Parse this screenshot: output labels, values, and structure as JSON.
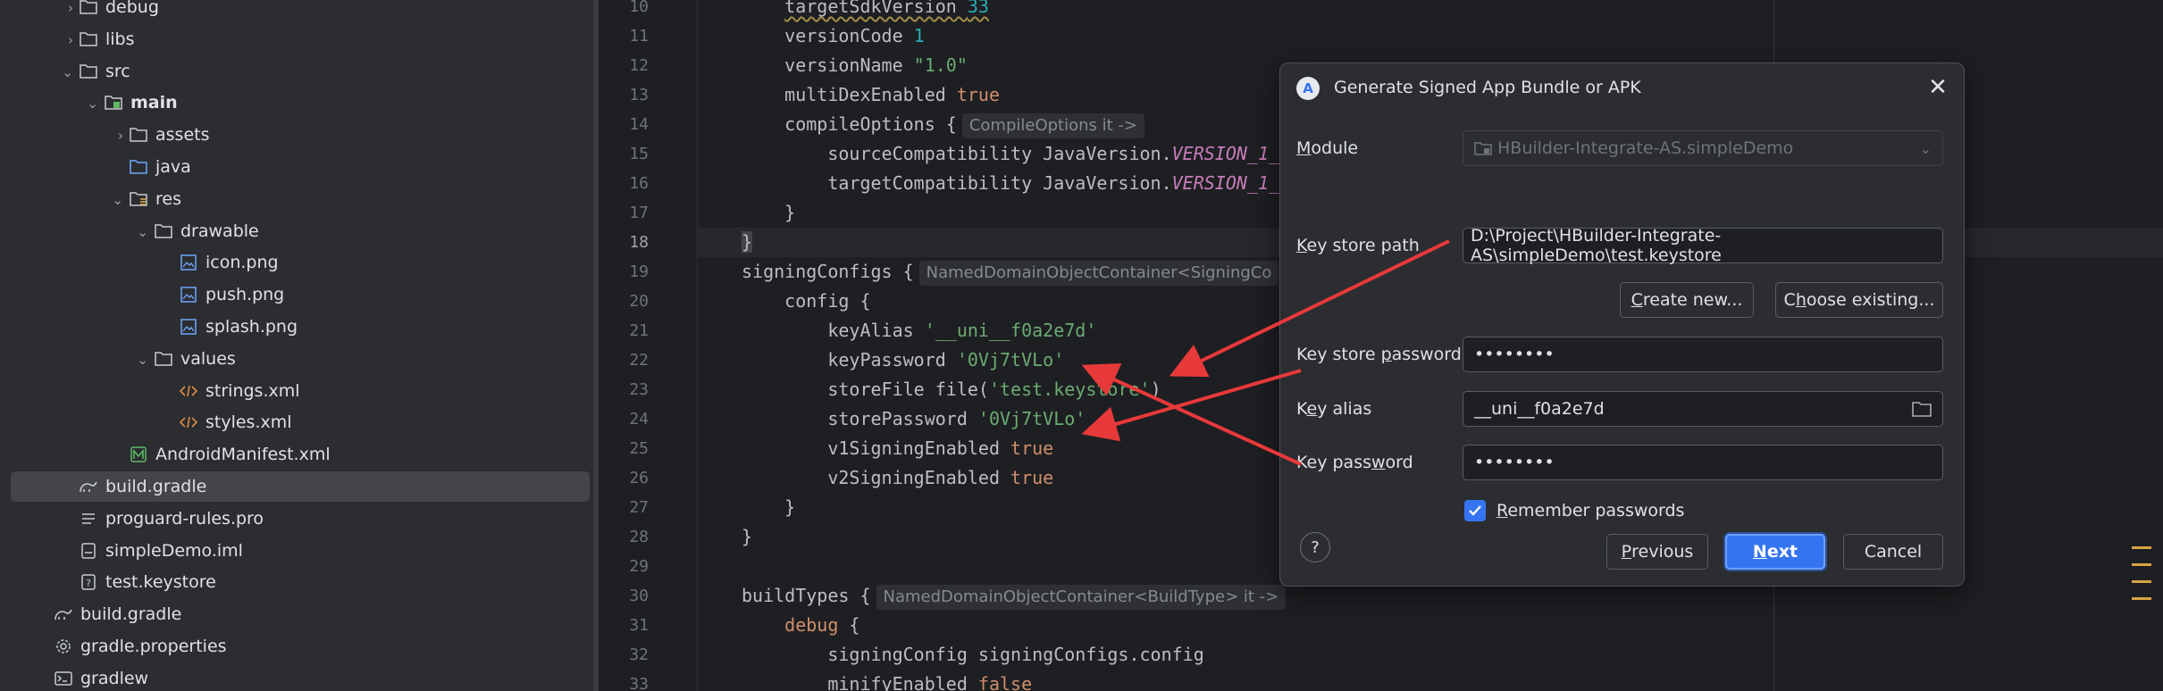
{
  "tree": {
    "items": [
      {
        "label": "debug",
        "depth": 2,
        "chevron": "›",
        "icon": "folder-icon"
      },
      {
        "label": "libs",
        "depth": 2,
        "chevron": "›",
        "icon": "folder-icon"
      },
      {
        "label": "src",
        "depth": 2,
        "chevron": "⌄",
        "icon": "folder-icon"
      },
      {
        "label": "main",
        "depth": 3,
        "chevron": "⌄",
        "icon": "source-folder-icon",
        "bold": true
      },
      {
        "label": "assets",
        "depth": 4,
        "chevron": "›",
        "icon": "folder-icon"
      },
      {
        "label": "java",
        "depth": 4,
        "chevron": "",
        "icon": "java-folder-icon"
      },
      {
        "label": "res",
        "depth": 4,
        "chevron": "⌄",
        "icon": "res-folder-icon"
      },
      {
        "label": "drawable",
        "depth": 5,
        "chevron": "⌄",
        "icon": "folder-icon"
      },
      {
        "label": "icon.png",
        "depth": 6,
        "chevron": "",
        "icon": "image-file-icon"
      },
      {
        "label": "push.png",
        "depth": 6,
        "chevron": "",
        "icon": "image-file-icon"
      },
      {
        "label": "splash.png",
        "depth": 6,
        "chevron": "",
        "icon": "image-file-icon"
      },
      {
        "label": "values",
        "depth": 5,
        "chevron": "⌄",
        "icon": "folder-icon"
      },
      {
        "label": "strings.xml",
        "depth": 6,
        "chevron": "",
        "icon": "xml-file-icon"
      },
      {
        "label": "styles.xml",
        "depth": 6,
        "chevron": "",
        "icon": "xml-file-icon"
      },
      {
        "label": "AndroidManifest.xml",
        "depth": 4,
        "chevron": "",
        "icon": "manifest-file-icon"
      },
      {
        "label": "build.gradle",
        "depth": 2,
        "chevron": "",
        "icon": "gradle-file-icon",
        "selected": true
      },
      {
        "label": "proguard-rules.pro",
        "depth": 2,
        "chevron": "",
        "icon": "text-file-icon"
      },
      {
        "label": "simpleDemo.iml",
        "depth": 2,
        "chevron": "",
        "icon": "iml-file-icon"
      },
      {
        "label": "test.keystore",
        "depth": 2,
        "chevron": "",
        "icon": "unknown-file-icon"
      },
      {
        "label": "build.gradle",
        "depth": 1,
        "chevron": "",
        "icon": "gradle-file-icon"
      },
      {
        "label": "gradle.properties",
        "depth": 1,
        "chevron": "",
        "icon": "settings-file-icon"
      },
      {
        "label": "gradlew",
        "depth": 1,
        "chevron": "",
        "icon": "terminal-file-icon"
      }
    ]
  },
  "editor": {
    "current_line": "18",
    "lines": [
      {
        "n": "10",
        "html": "    <span class=\"under\">targetSdkVersion <span class=\"num\">33</span></span>"
      },
      {
        "n": "11",
        "html": "    versionCode <span class=\"num\">1</span>"
      },
      {
        "n": "12",
        "html": "    versionName <span class=\"str\">\"1.0\"</span>"
      },
      {
        "n": "13",
        "html": "    multiDexEnabled <span class=\"kw\">true</span>"
      },
      {
        "n": "14",
        "html": "    compileOptions {<span class=\"hint\">CompileOptions it -&gt;</span>"
      },
      {
        "n": "15",
        "html": "        sourceCompatibility JavaVersion.<span class=\"const\">VERSION_1_</span>"
      },
      {
        "n": "16",
        "html": "        targetCompatibility JavaVersion.<span class=\"const\">VERSION_1_</span>"
      },
      {
        "n": "17",
        "html": "    }"
      },
      {
        "n": "18",
        "html": "<span class=\"brace-hl\">}</span>"
      },
      {
        "n": "19",
        "html": "signingConfigs {<span class=\"hint\">NamedDomainObjectContainer&lt;SigningCo</span>"
      },
      {
        "n": "20",
        "html": "    config {"
      },
      {
        "n": "21",
        "html": "        keyAlias <span class=\"str\">'__uni__f0a2e7d'</span>"
      },
      {
        "n": "22",
        "html": "        keyPassword <span class=\"str\">'0Vj7tVLo'</span>"
      },
      {
        "n": "23",
        "html": "        storeFile file(<span class=\"str\">'test.keystore'</span>)"
      },
      {
        "n": "24",
        "html": "        storePassword <span class=\"str\">'0Vj7tVLo'</span>"
      },
      {
        "n": "25",
        "html": "        v1SigningEnabled <span class=\"kw\">true</span>"
      },
      {
        "n": "26",
        "html": "        v2SigningEnabled <span class=\"kw\">true</span>"
      },
      {
        "n": "27",
        "html": "    }"
      },
      {
        "n": "28",
        "html": "}"
      },
      {
        "n": "29",
        "html": ""
      },
      {
        "n": "30",
        "html": "buildTypes {<span class=\"hint\">NamedDomainObjectContainer&lt;BuildType&gt; it -&gt;</span>"
      },
      {
        "n": "31",
        "html": "    <span class=\"kw\">debug</span> {"
      },
      {
        "n": "32",
        "html": "        signingConfig signingConfigs.config"
      },
      {
        "n": "33",
        "html": "        minifyEnabled <span class=\"kw\">false</span>"
      }
    ]
  },
  "dialog": {
    "title": "Generate Signed App Bundle or APK",
    "module_label_m": "M",
    "module_label_rest": "odule",
    "module_value": "HBuilder-Integrate-AS.simpleDemo",
    "keystore_path_label_k": "K",
    "keystore_path_label_rest": "ey store path",
    "keystore_path_value": "D:\\Project\\HBuilder-Integrate-AS\\simpleDemo\\test.keystore",
    "create_new_c": "C",
    "create_new_rest": "reate new...",
    "choose_existing_pre": "C",
    "choose_existing_h": "h",
    "choose_existing_rest": "oose existing...",
    "keystore_password_pre": "Key store ",
    "keystore_password_p": "p",
    "keystore_password_rest": "assword",
    "keystore_password_value": "••••••••",
    "key_alias_pre": "K",
    "key_alias_e": "e",
    "key_alias_rest": "y alias",
    "key_alias_value": "__uni__f0a2e7d",
    "key_password_pre": "Key pass",
    "key_password_w": "w",
    "key_password_rest": "ord",
    "key_password_value": "••••••••",
    "remember_r": "R",
    "remember_rest": "emember passwords",
    "remember_checked": true,
    "help_label": "?",
    "previous_p": "P",
    "previous_rest": "revious",
    "next_n": "N",
    "next_rest": "ext",
    "cancel_label": "Cancel"
  },
  "colors": {
    "accent": "#3574f0",
    "arrow": "#e8393a",
    "string": "#6aab73",
    "keyword": "#cf8e6d"
  }
}
